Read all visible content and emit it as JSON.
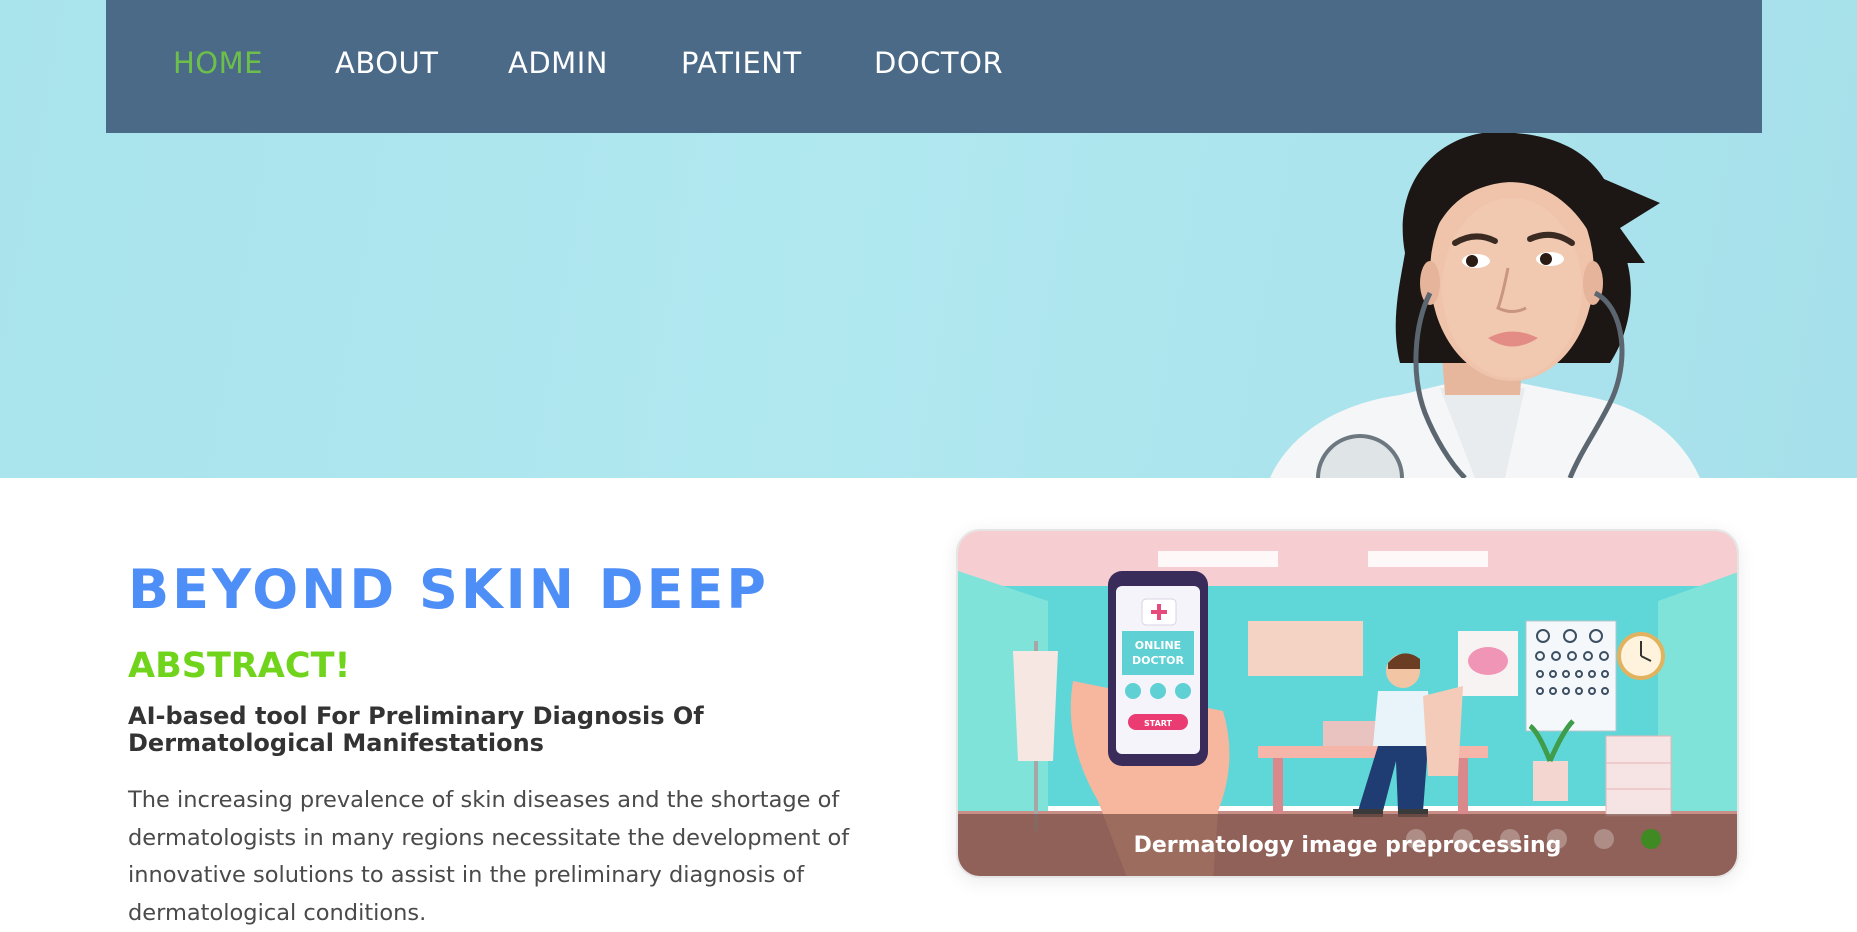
{
  "nav": {
    "items": [
      {
        "label": "HOME",
        "active": true
      },
      {
        "label": "ABOUT",
        "active": false
      },
      {
        "label": "ADMIN",
        "active": false
      },
      {
        "label": "PATIENT",
        "active": false
      },
      {
        "label": "DOCTOR",
        "active": false
      }
    ]
  },
  "main": {
    "title": "BEYOND SKIN DEEP",
    "abstract_heading": "ABSTRACT!",
    "subtitle": "AI-based tool For Preliminary Diagnosis Of Dermatological Manifestations",
    "body": "The increasing prevalence of skin diseases and the shortage of dermatologists in many regions necessitate the development of innovative solutions to assist in the preliminary diagnosis of dermatological conditions."
  },
  "carousel": {
    "caption": "Dermatology image preprocessing",
    "slide_count": 6,
    "active_slide": 5,
    "phone_title_line1": "ONLINE",
    "phone_title_line2": "DOCTOR",
    "phone_button": "START"
  },
  "colors": {
    "nav_bg": "#4a6a87",
    "nav_active": "#6cc04a",
    "title": "#4e8ef7",
    "abstract": "#6fd41b"
  }
}
